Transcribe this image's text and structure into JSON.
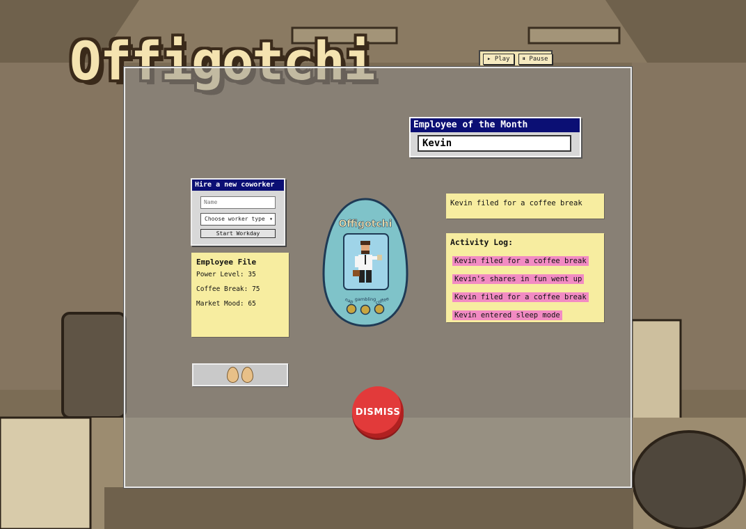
{
  "app": {
    "logo_text": "Offigotchi"
  },
  "controls": {
    "play_label": "▸ Play",
    "pause_label": "⏸ Pause"
  },
  "employee_of_month": {
    "title": "Employee of the Month",
    "name": "Kevin"
  },
  "hire": {
    "title": "Hire a new coworker",
    "name_placeholder": "Name",
    "worker_type_selected": "Choose worker type",
    "start_label": "Start Workday"
  },
  "employee_file": {
    "title": "Employee File",
    "stats": [
      "Power Level: 35",
      "Coffee Break: 75",
      "Market Mood: 65"
    ]
  },
  "eggs": {
    "count": 2
  },
  "status": {
    "message": "Kevin filed for a coffee break"
  },
  "activity_log": {
    "title": "Activity Log:",
    "items": [
      "Kevin filed for a coffee break",
      "Kevin's shares in fun went up",
      "Kevin filed for a coffee break",
      "Kevin entered sleep mode"
    ]
  },
  "device": {
    "brand": "Offigotchi",
    "buttons": [
      "nap",
      "gambling",
      "coffee"
    ]
  },
  "dismiss": {
    "label": "DISMISS"
  },
  "colors": {
    "titlebar": "#0b0f74",
    "sticky": "#f7eda0",
    "highlight": "#f28bc3",
    "dismiss": "#e23a3a",
    "logo": "#f4e3b0"
  }
}
